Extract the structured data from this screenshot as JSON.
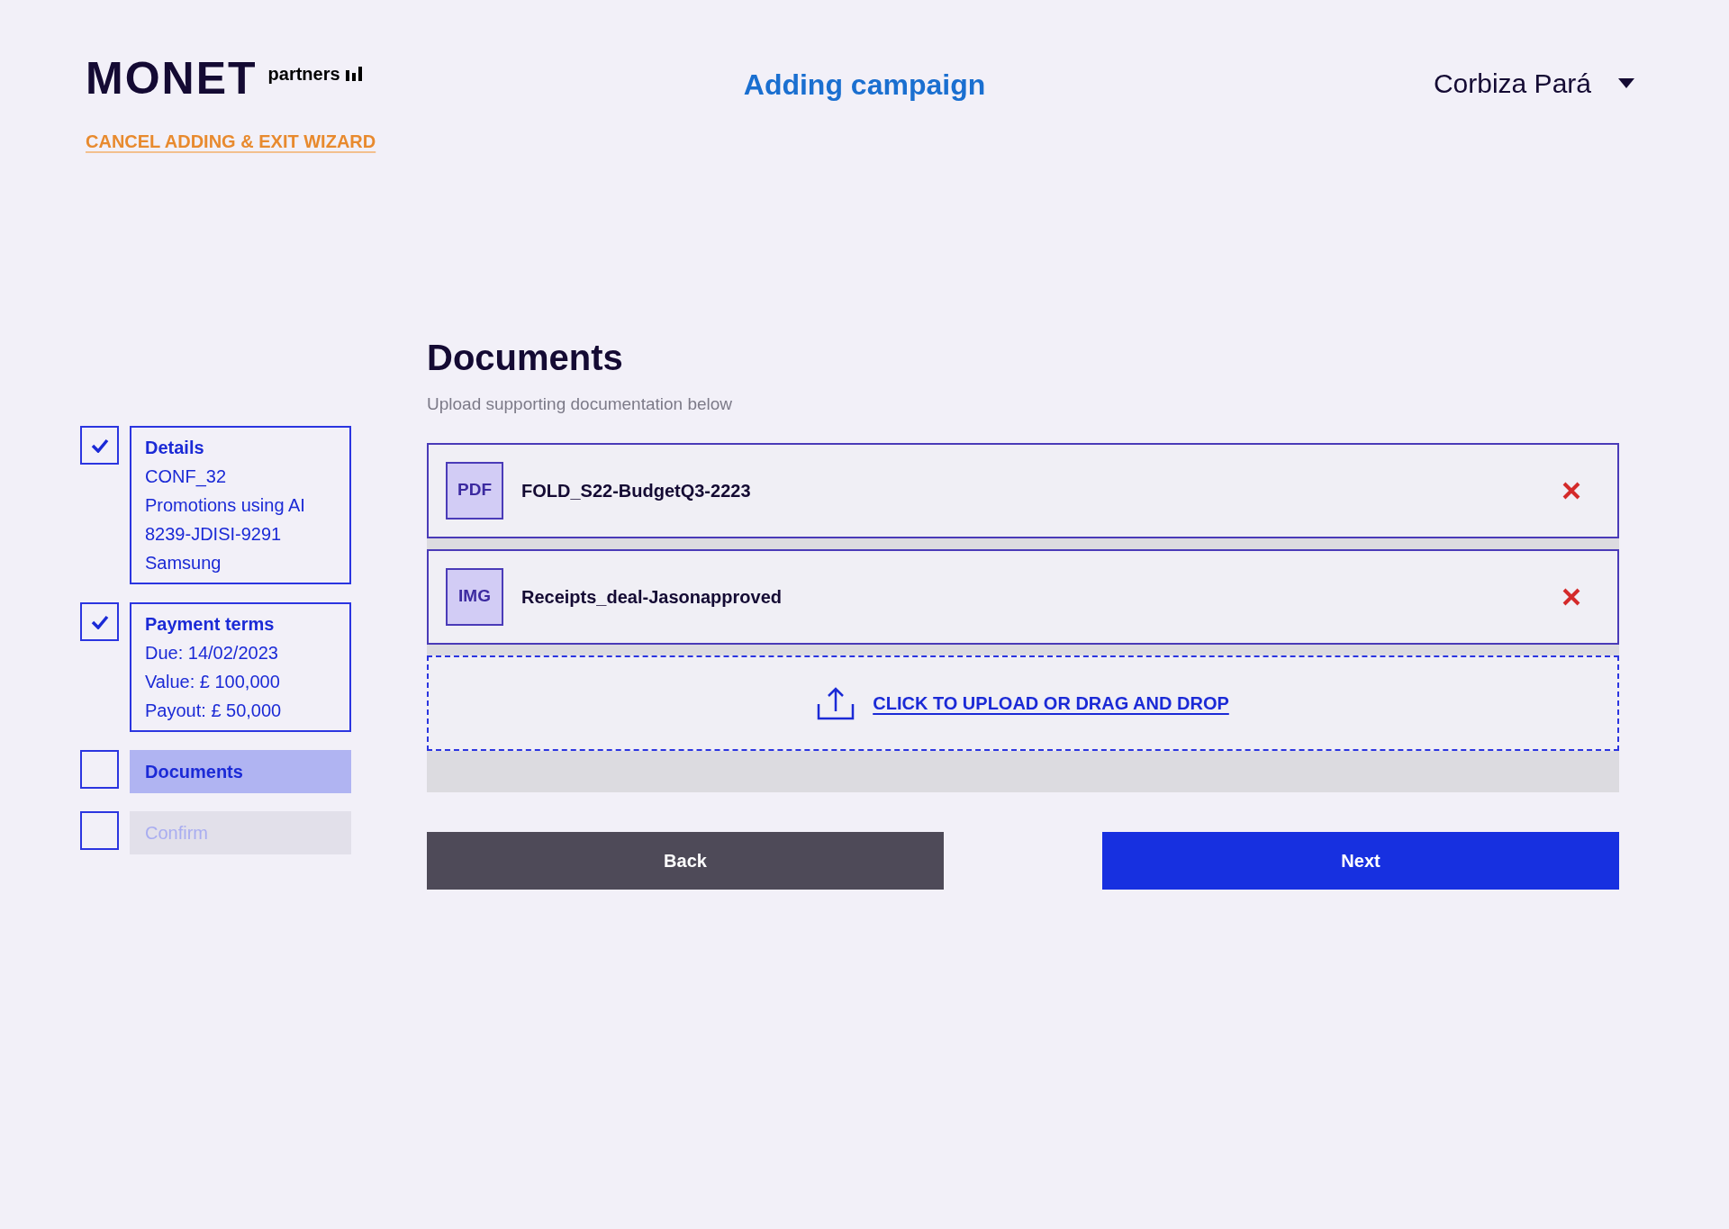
{
  "header": {
    "logo": {
      "wordmark": "MONET",
      "tagline": "partners"
    },
    "title": "Adding campaign",
    "user": {
      "name": "Corbiza Pará"
    }
  },
  "cancel_link": "CANCEL ADDING & EXIT WIZARD",
  "steps": [
    {
      "kind": "completed",
      "checked": true,
      "title": "Details",
      "lines": [
        "CONF_32",
        "Promotions using AI",
        "8239-JDISI-9291",
        "Samsung"
      ]
    },
    {
      "kind": "completed",
      "checked": true,
      "title": "Payment terms",
      "lines": [
        "Due: 14/02/2023",
        "Value: £ 100,000",
        "Payout: £ 50,000"
      ]
    },
    {
      "kind": "current",
      "checked": false,
      "title": "Documents"
    },
    {
      "kind": "upcoming",
      "checked": false,
      "title": "Confirm"
    }
  ],
  "main": {
    "heading": "Documents",
    "subtitle": "Upload supporting documentation below",
    "files": [
      {
        "type": "PDF",
        "name": "FOLD_S22-BudgetQ3-2223"
      },
      {
        "type": "IMG",
        "name": "Receipts_deal-Jasonapproved"
      }
    ],
    "upload": "CLICK TO UPLOAD OR DRAG AND DROP",
    "buttons": [
      {
        "kind": "secondary",
        "label": "Back"
      },
      {
        "kind": "primary",
        "label": "Next"
      }
    ]
  }
}
